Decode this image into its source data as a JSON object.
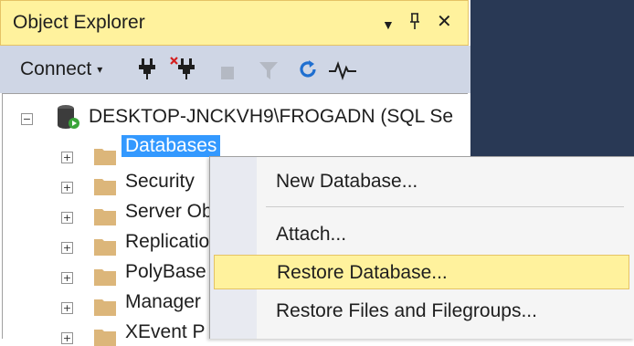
{
  "window": {
    "title": "Object Explorer",
    "pin_glyph": "▾  ╨",
    "close_glyph": "✕"
  },
  "toolbar": {
    "connect_label": "Connect",
    "connect_arrow": "▾",
    "icons": [
      "connect-plug-icon",
      "disconnect-plug-icon",
      "stop-icon",
      "filter-icon",
      "refresh-icon",
      "activity-monitor-icon"
    ]
  },
  "tree": {
    "server": "DESKTOP-JNCKVH9\\FROGADN (SQL Se",
    "server_expander": "−",
    "nodes": [
      {
        "label": "Databases",
        "expander": "+"
      },
      {
        "label": "Security",
        "expander": "+"
      },
      {
        "label": "Server Ob",
        "expander": "+"
      },
      {
        "label": "Replicatio",
        "expander": "+"
      },
      {
        "label": "PolyBase",
        "expander": "+"
      },
      {
        "label": "Manager",
        "expander": "+"
      },
      {
        "label": "XEvent P",
        "expander": "+"
      }
    ]
  },
  "context_menu": {
    "items": [
      {
        "label": "New Database..."
      },
      {
        "label": "Attach..."
      },
      {
        "label": "Restore Database..."
      },
      {
        "label": "Restore Files and Filegroups..."
      }
    ]
  },
  "colors": {
    "title_bg": "#fff29d",
    "toolbar_bg": "#cfd6e5",
    "selection": "#3399ff",
    "menu_hover": "#fff29d",
    "dark_bg": "#293955"
  }
}
